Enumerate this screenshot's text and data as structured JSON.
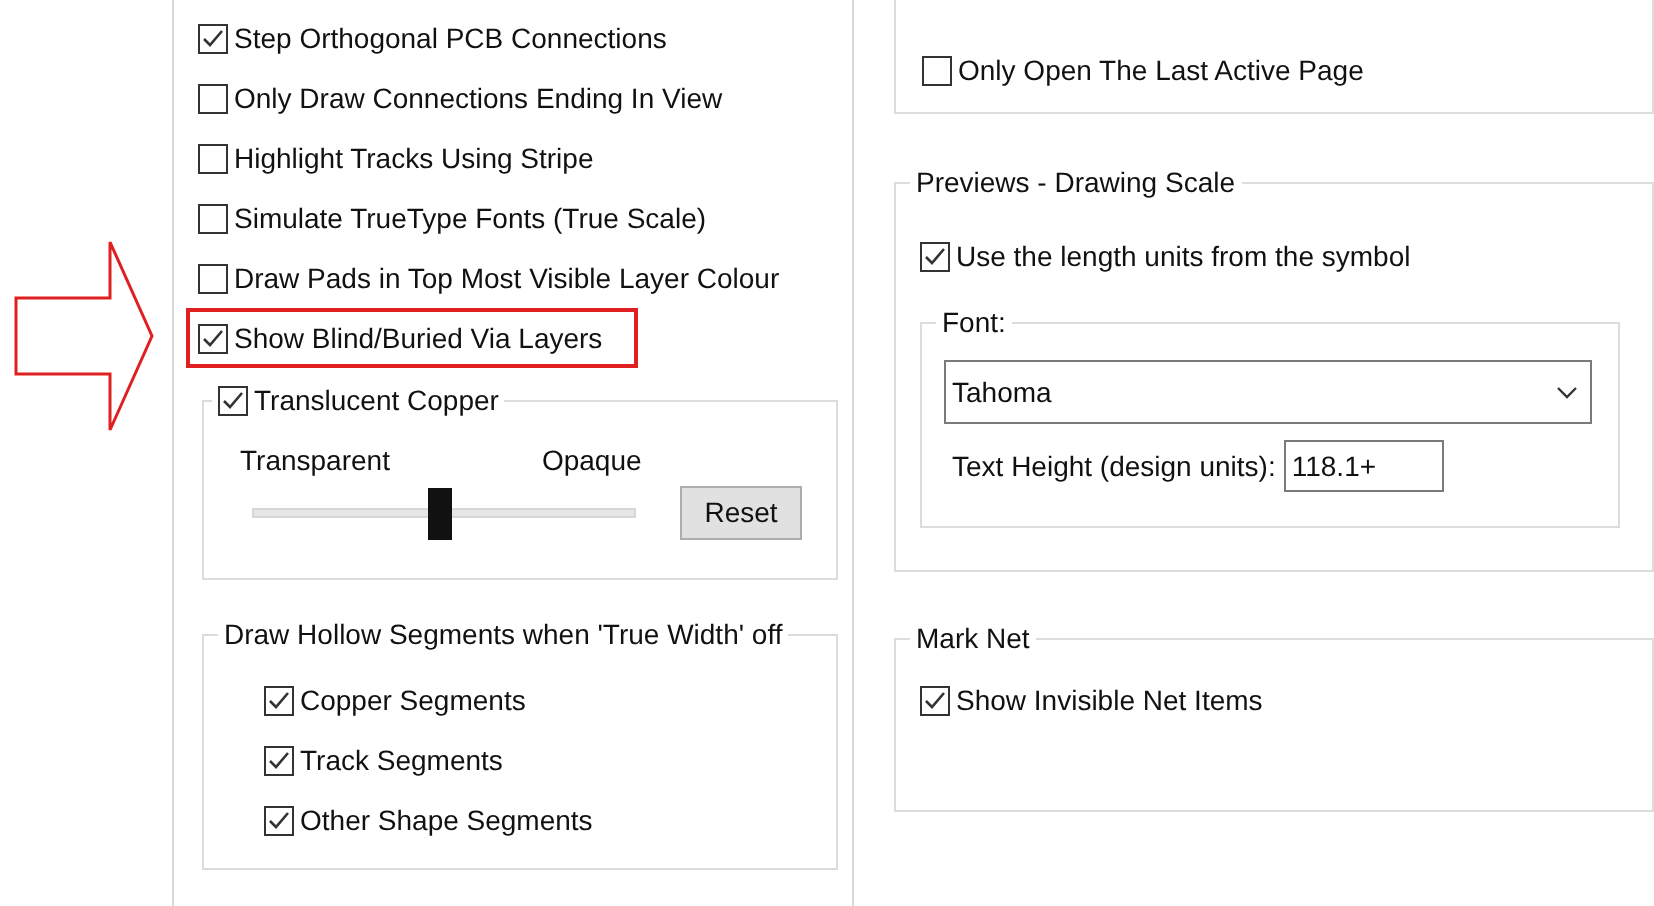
{
  "left": {
    "options": [
      {
        "label": "Step Orthogonal PCB Connections",
        "checked": true,
        "highlighted": false
      },
      {
        "label": "Only Draw Connections Ending In View",
        "checked": false,
        "highlighted": false
      },
      {
        "label": "Highlight Tracks Using Stripe",
        "checked": false,
        "highlighted": false
      },
      {
        "label": "Simulate TrueType Fonts (True Scale)",
        "checked": false,
        "highlighted": false
      },
      {
        "label": "Draw Pads in Top Most Visible Layer Colour",
        "checked": false,
        "highlighted": false
      },
      {
        "label": "Show Blind/Buried Via Layers",
        "checked": true,
        "highlighted": true
      }
    ],
    "translucent": {
      "label": "Translucent Copper",
      "checked": true,
      "min_label": "Transparent",
      "max_label": "Opaque",
      "level": 0.49,
      "button": "Reset"
    },
    "hollow": {
      "title": "Draw Hollow Segments when 'True Width' off",
      "items": [
        {
          "label": "Copper Segments",
          "checked": true
        },
        {
          "label": "Track Segments",
          "checked": true
        },
        {
          "label": "Other Shape Segments",
          "checked": true
        }
      ]
    }
  },
  "right": {
    "top_options": [
      {
        "label": "Only Open The Last Active Page",
        "checked": false
      }
    ],
    "previews": {
      "title": "Previews - Drawing Scale",
      "option": {
        "label": "Use the length units from the symbol",
        "checked": true
      },
      "font": {
        "title": "Font:",
        "value": "Tahoma",
        "height_label": "Text Height (design units):",
        "height_value": "118.1+"
      }
    },
    "mark_net": {
      "title": "Mark Net",
      "option": {
        "label": "Show Invisible Net Items",
        "checked": true
      }
    }
  }
}
